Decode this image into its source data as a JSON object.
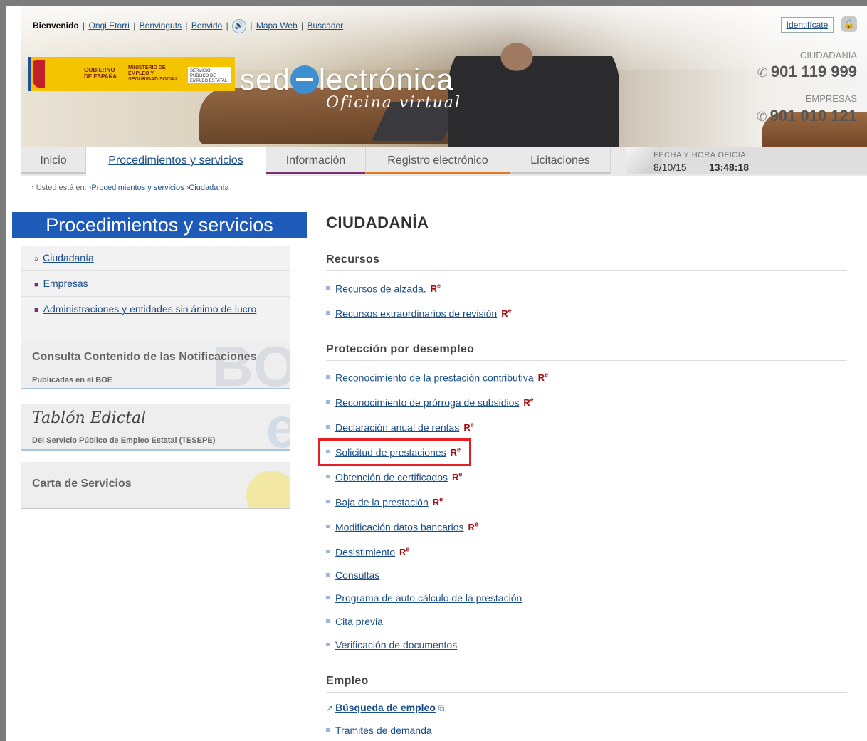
{
  "toplinks": {
    "welcome": "Bienvenido",
    "lang1": "Ongi Etorri",
    "lang2": "Benvinguts",
    "lang3": "Benvido",
    "sitemap": "Mapa Web",
    "search": "Buscador"
  },
  "header": {
    "identify": "Identifícate",
    "brand_pre": "sed",
    "brand_post": "lectrónica",
    "tagline": "Oficina virtual",
    "logo_gov": "GOBIERNO DE ESPAÑA",
    "logo_ministry": "MINISTERIO DE EMPLEO Y SEGURIDAD SOCIAL",
    "logo_spe": "SERVICIO PÚBLICO DE EMPLEO ESTATAL",
    "citizens_label": "CIUDADANÍA",
    "citizens_phone": "901 119 999",
    "business_label": "EMPRESAS",
    "business_phone": "901 010 121"
  },
  "nav": {
    "tabs": [
      "Inicio",
      "Procedimientos y servicios",
      "Información",
      "Registro electrónico",
      "Licitaciones"
    ],
    "official_label": "FECHA Y HORA OFICIAL",
    "date": "8/10/15",
    "time": "13:48:18"
  },
  "breadcrumb": {
    "prefix": "Usted está en:",
    "items": [
      "Procedimientos y servicios",
      "Ciudadanía"
    ]
  },
  "sidebar": {
    "title": "Procedimientos y servicios",
    "items": [
      "Ciudadanía",
      "Empresas",
      "Administraciones y entidades sin ánimo de lucro"
    ],
    "notif_title": "Consulta Contenido de las Notificaciones",
    "notif_sub": "Publicadas en el BOE",
    "tablon_title": "Tablón Edictal",
    "tablon_sub": "Del Servicio Público de Empleo Estatal (TESEPE)",
    "carta": "Carta de Servicios"
  },
  "main": {
    "title": "CIUDADANÍA",
    "sec_recursos": "Recursos",
    "recursos": [
      "Recursos de alzada.",
      "Recursos extraordinarios de revisión"
    ],
    "sec_proteccion": "Protección por desempleo",
    "proteccion_re": [
      "Reconocimiento de la prestación contributiva",
      "Reconocimiento de prórroga de subsidios",
      "Declaración anual de rentas",
      "Solicitud de prestaciones",
      "Obtención de certificados",
      "Baja de la prestación",
      "Modificación datos bancarios",
      "Desistimiento"
    ],
    "proteccion_plain": [
      "Consultas",
      "Programa de auto cálculo de la prestación",
      "Cita previa",
      "Verificación de documentos"
    ],
    "sec_empleo": "Empleo",
    "empleo": [
      "Búsqueda de empleo",
      "Trámites de demanda"
    ],
    "re_mark": "R",
    "re_sup": "e"
  }
}
